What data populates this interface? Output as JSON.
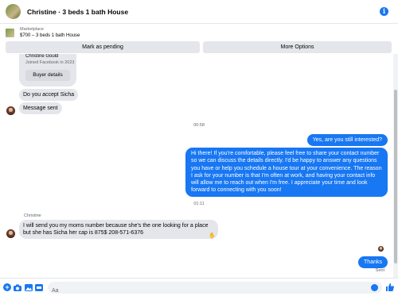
{
  "header": {
    "title": "Christine · 3 beds 1 bath House",
    "info_icon": "info-icon"
  },
  "listing": {
    "label": "Marketplace",
    "subtitle": "$700 – 3 beds 1 bath House"
  },
  "actions": {
    "mark_pending": "Mark as pending",
    "more_options": "More Options"
  },
  "buyer_card": {
    "name": "Christine Gould",
    "joined": "Joined Facebook in 2023",
    "details_button": "Buyer details"
  },
  "messages": {
    "incoming_1": "Do you accept Sicha",
    "incoming_2": "Message sent",
    "timestamp_1": "00:58",
    "outgoing_1": "Yes, are you still interested?",
    "outgoing_2": "Hi there! If you're comfortable, please feel free to share your contact number so we can discuss the details directly. I'd be happy to answer any questions you have or help you schedule a house tour at your convenience. The reason I ask for your number is that I'm often at work, and having your contact info will allow me to reach out when I'm free. I appreciate your time and look forward to connecting with you soon!",
    "timestamp_2": "01:11",
    "sender_name": "Christine",
    "incoming_3": "I will send you my moms number because she's the one looking for a place but she has Sicha her cap is 875$ 208-571-6376",
    "outgoing_3": "Thanks",
    "status": "Sent"
  },
  "composer": {
    "placeholder": "Aa"
  },
  "colors": {
    "accent": "#1877f2",
    "bubble_in": "#e4e6eb"
  }
}
